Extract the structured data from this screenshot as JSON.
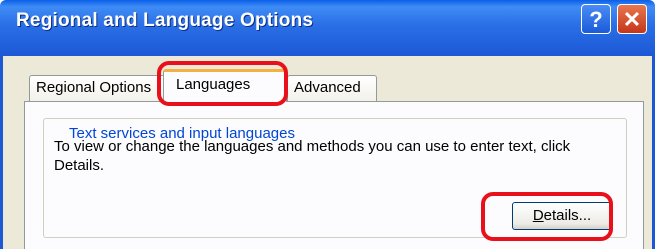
{
  "window": {
    "title": "Regional and Language Options",
    "help_button": "?",
    "close_button": "✕"
  },
  "tabs": [
    {
      "label": "Regional Options",
      "selected": false
    },
    {
      "label": "Languages",
      "selected": true
    },
    {
      "label": "Advanced",
      "selected": false
    }
  ],
  "group": {
    "title": "Text services and input languages",
    "description": "To view or change the languages and methods you can use to enter text, click Details."
  },
  "details_button": {
    "accel": "D",
    "rest": "etails..."
  },
  "colors": {
    "titlebar": "#1c58d6",
    "highlight": "#e8101a",
    "group_title": "#0046d5",
    "dialog_bg": "#ece9d8"
  }
}
